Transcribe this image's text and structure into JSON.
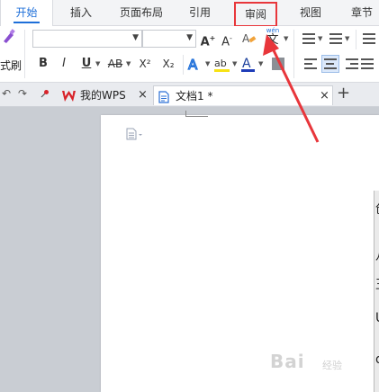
{
  "tabs": [
    {
      "label": "开始"
    },
    {
      "label": "插入"
    },
    {
      "label": "页面布局"
    },
    {
      "label": "引用"
    },
    {
      "label": "审阅"
    },
    {
      "label": "视图"
    },
    {
      "label": "章节"
    }
  ],
  "ribbon": {
    "format_painter_label": "式刷",
    "bold": "B",
    "italic": "I",
    "underline": "U",
    "strike": "AB",
    "superscript": "X²",
    "subscript": "X₂",
    "phonetic": "wén",
    "phonetic_char": "文"
  },
  "docbar": {
    "wps_tab": "我的WPS",
    "doc_tab": "文档1 *",
    "close": "×",
    "add": "+"
  },
  "page_edge_text": [
    "创",
    "八",
    "王",
    "U",
    "d"
  ],
  "watermark": {
    "main": "Bai",
    "sub": "经验"
  },
  "colors": {
    "accent": "#1e6fd9",
    "highlight": "#e8363b"
  }
}
